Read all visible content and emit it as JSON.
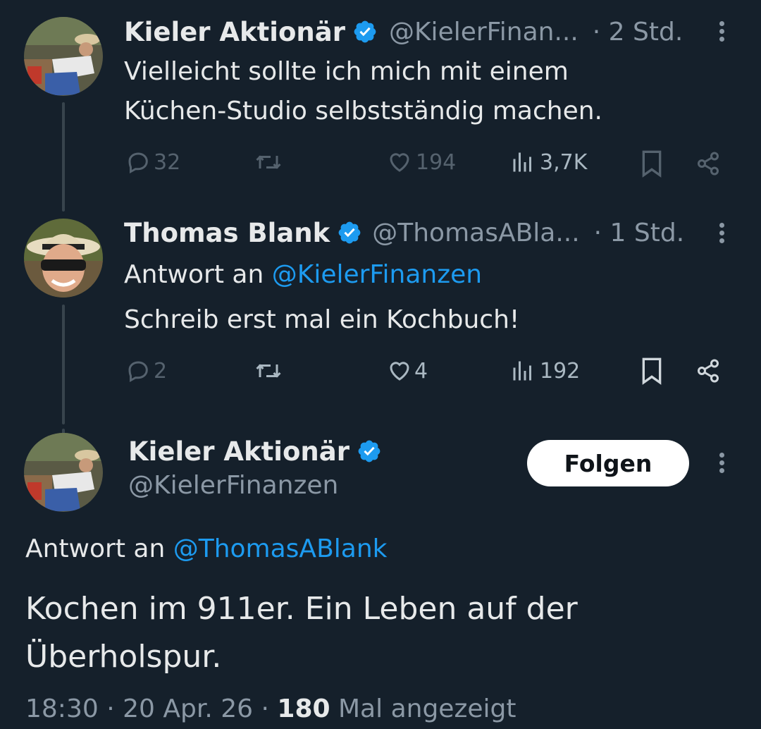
{
  "tweet1": {
    "name": "Kieler Aktionär",
    "handle": "@KielerFinan...",
    "time": "· 2 Std.",
    "text_line1": "Vielleicht sollte ich mich mit einem",
    "text_line2": "Küchen-Studio selbstständig machen.",
    "replies": "32",
    "likes": "194",
    "views": "3,7K"
  },
  "tweet2": {
    "name": "Thomas Blank",
    "handle": "@ThomasABla...",
    "time": "· 1 Std.",
    "reply_prefix": "Antwort an",
    "reply_to": "@KielerFinanzen",
    "text": "Schreib erst mal ein Kochbuch!",
    "replies": "2",
    "likes": "4",
    "views": "192"
  },
  "main": {
    "name": "Kieler Aktionär",
    "handle": "@KielerFinanzen",
    "follow_label": "Folgen",
    "reply_prefix": "Antwort an",
    "reply_to": "@ThomasABlank",
    "text_line1": "Kochen im 911er. Ein Leben auf der",
    "text_line2": "Überholspur.",
    "time": "18:30",
    "date": "20 Apr. 26",
    "views_count": "180",
    "views_label": "Mal angezeigt"
  },
  "colors": {
    "background": "#15202b",
    "text": "#e7e9ea",
    "muted": "#8b98a5",
    "link": "#1d9bf0",
    "verified": "#1d9bf0"
  },
  "icons": [
    "verified-badge-icon",
    "more-icon",
    "reply-icon",
    "repost-icon",
    "like-icon",
    "views-icon",
    "bookmark-icon",
    "share-icon"
  ]
}
